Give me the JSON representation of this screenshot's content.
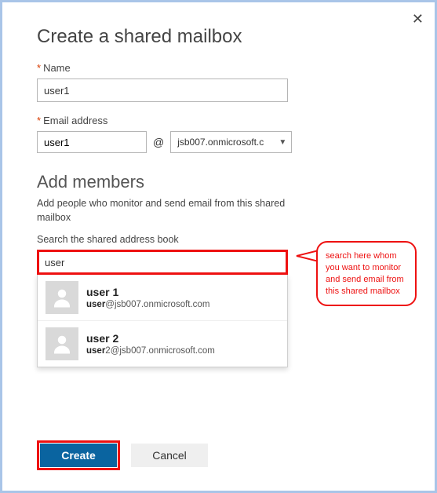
{
  "close_icon": "✕",
  "page_title": "Create a shared mailbox",
  "name": {
    "required_mark": "*",
    "label": "Name",
    "value": "user1"
  },
  "email": {
    "required_mark": "*",
    "label": "Email address",
    "local_value": "user1",
    "at": "@",
    "domain_display": "jsb007.onmicrosoft.c",
    "chevron": "▼"
  },
  "members": {
    "header": "Add members",
    "description": "Add people who monitor and send email from this shared mailbox",
    "search_label": "Search the shared address book",
    "search_value": "user",
    "results": [
      {
        "display_name": "user 1",
        "email_bold": "user",
        "email_rest": "@jsb007.onmicrosoft.com"
      },
      {
        "display_name": "user 2",
        "email_bold": "user",
        "email_rest": "2@jsb007.onmicrosoft.com"
      }
    ]
  },
  "callout_text": "search here whom you want to monitor and send email from this shared mailbox",
  "buttons": {
    "create": "Create",
    "cancel": "Cancel"
  }
}
